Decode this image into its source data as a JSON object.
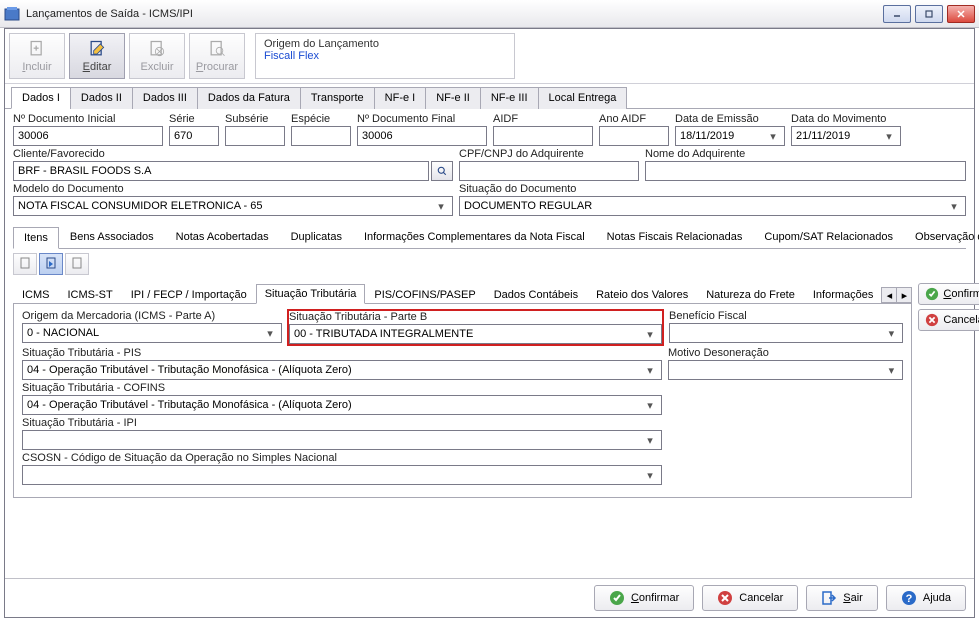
{
  "window": {
    "title": "Lançamentos de Saída - ICMS/IPI"
  },
  "toolbar": {
    "incluir": "Incluir",
    "editar": "Editar",
    "excluir": "Excluir",
    "procurar": "Procurar"
  },
  "origin": {
    "label": "Origem do Lançamento",
    "value": "Fiscall Flex"
  },
  "main_tabs": [
    "Dados I",
    "Dados II",
    "Dados III",
    "Dados da Fatura",
    "Transporte",
    "NF-e I",
    "NF-e II",
    "NF-e III",
    "Local Entrega"
  ],
  "main_tab_active": 0,
  "fields": {
    "doc_inicial": {
      "label": "Nº Documento Inicial",
      "value": "30006"
    },
    "serie": {
      "label": "Série",
      "value": "670"
    },
    "subserie": {
      "label": "Subsérie",
      "value": ""
    },
    "especie": {
      "label": "Espécie",
      "value": ""
    },
    "doc_final": {
      "label": "Nº Documento Final",
      "value": "30006"
    },
    "aidf": {
      "label": "AIDF",
      "value": ""
    },
    "ano_aidf": {
      "label": "Ano AIDF",
      "value": ""
    },
    "data_emissao": {
      "label": "Data de Emissão",
      "value": "18/11/2019"
    },
    "data_movimento": {
      "label": "Data do Movimento",
      "value": "21/11/2019"
    },
    "cliente": {
      "label": "Cliente/Favorecido",
      "value": "BRF - BRASIL FOODS S.A"
    },
    "cpf_cnpj": {
      "label": "CPF/CNPJ do Adquirente",
      "value": ""
    },
    "nome_adq": {
      "label": "Nome do Adquirente",
      "value": ""
    },
    "modelo": {
      "label": "Modelo do Documento",
      "value": "NOTA FISCAL CONSUMIDOR ELETRONICA - 65"
    },
    "situacao_doc": {
      "label": "Situação do Documento",
      "value": "DOCUMENTO REGULAR"
    }
  },
  "sub_tabs": [
    "Itens",
    "Bens Associados",
    "Notas Acobertadas",
    "Duplicatas",
    "Informações Complementares da Nota Fiscal",
    "Notas Fiscais Relacionadas",
    "Cupom/SAT Relacionados",
    "Observação d"
  ],
  "sub_tab_active": 0,
  "inner_tabs": [
    "ICMS",
    "ICMS-ST",
    "IPI / FECP / Importação",
    "Situação Tributária",
    "PIS/COFINS/PASEP",
    "Dados Contábeis",
    "Rateio dos Valores",
    "Natureza do Frete",
    "Informações"
  ],
  "inner_tab_active": 3,
  "sit": {
    "origem": {
      "label": "Origem da Mercadoria (ICMS - Parte A)",
      "value": "0 - NACIONAL"
    },
    "parte_b": {
      "label": "Situação Tributária - Parte B",
      "value": "00 - TRIBUTADA INTEGRALMENTE"
    },
    "beneficio": {
      "label": "Benefício Fiscal",
      "value": ""
    },
    "pis": {
      "label": "Situação Tributária - PIS",
      "value": "04 - Operação Tributável - Tributação Monofásica - (Alíquota Zero)"
    },
    "motivo": {
      "label": "Motivo Desoneração",
      "value": ""
    },
    "cofins": {
      "label": "Situação Tributária - COFINS",
      "value": "04 - Operação Tributável - Tributação Monofásica - (Alíquota Zero)"
    },
    "ipi": {
      "label": "Situação Tributária - IPI",
      "value": ""
    },
    "csosn": {
      "label": "CSOSN - Código de Situação da Operação no Simples Nacional",
      "value": ""
    }
  },
  "side": {
    "confirmar": "Confirmar",
    "cancelar": "Cancelar"
  },
  "bottom": {
    "confirmar": "Confirmar",
    "cancelar": "Cancelar",
    "sair": "Sair",
    "ajuda": "Ajuda"
  }
}
